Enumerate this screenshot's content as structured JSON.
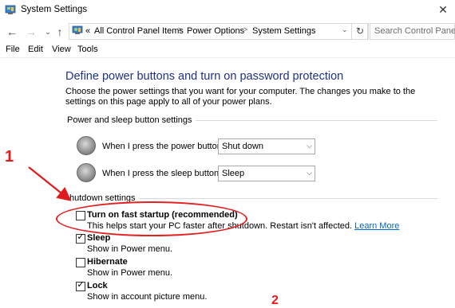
{
  "window": {
    "title": "System Settings"
  },
  "address_bar": {
    "prefix": "«",
    "crumbs": [
      "All Control Panel Items",
      "Power Options",
      "System Settings"
    ],
    "search_placeholder": "Search Control Panel"
  },
  "menu": [
    "File",
    "Edit",
    "View",
    "Tools"
  ],
  "page": {
    "heading": "Define power buttons and turn on password protection",
    "description": "Choose the power settings that you want for your computer. The changes you make to the settings on this page apply to all of your power plans.",
    "power_section_label": "Power and sleep button settings",
    "power_button_label": "When I press the power button:",
    "power_button_value": "Shut down",
    "sleep_button_label": "When I press the sleep button:",
    "sleep_button_value": "Sleep",
    "shutdown_section_label": "hutdown settings",
    "options": [
      {
        "label": "Turn on fast startup (recommended)",
        "sub": "This helps start your PC faster after shutdown. Restart isn't affected.",
        "link": "Learn More",
        "checked": false
      },
      {
        "label": "Sleep",
        "sub": "Show in Power menu.",
        "checked": true
      },
      {
        "label": "Hibernate",
        "sub": "Show in Power menu.",
        "checked": false
      },
      {
        "label": "Lock",
        "sub": "Show in account picture menu.",
        "checked": true
      }
    ]
  },
  "annotations": {
    "marker_1": "1",
    "marker_2": "2"
  },
  "colors": {
    "heading": "#1e3287",
    "link": "#0066cc",
    "annotation": "#e01b1b"
  },
  "icons": [
    "control-panel-icon",
    "back-arrow-icon",
    "forward-arrow-icon",
    "dropdown-arrow-icon",
    "up-arrow-icon",
    "refresh-icon",
    "power-button-icon",
    "sleep-button-icon",
    "close-icon"
  ]
}
